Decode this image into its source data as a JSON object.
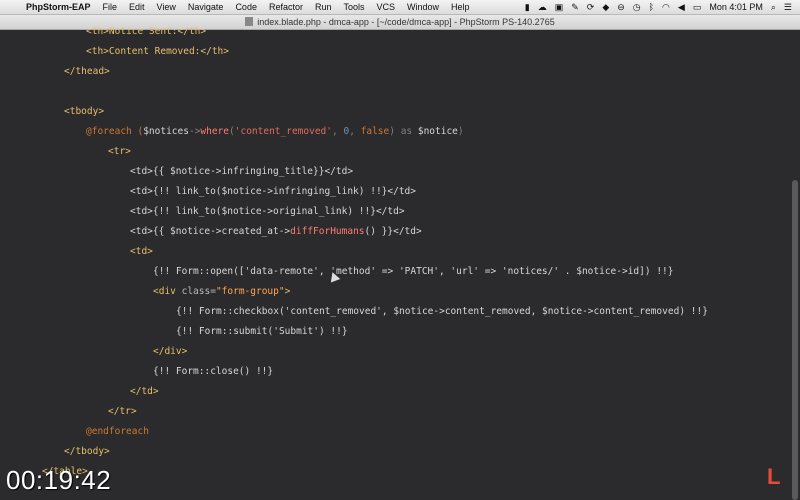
{
  "menubar": {
    "app": "PhpStorm-EAP",
    "items": [
      "File",
      "Edit",
      "View",
      "Navigate",
      "Code",
      "Refactor",
      "Run",
      "Tools",
      "VCS",
      "Window",
      "Help"
    ],
    "clock": "Mon 4:01 PM"
  },
  "window": {
    "title": "index.blade.php - dmca-app - [~/code/dmca-app] - PhpStorm PS-140.2765"
  },
  "code": {
    "l1": "<th>Notice Sent:</th>",
    "l2": "<th>Content Removed:</th>",
    "l3": "</thead>",
    "l4": "<tbody>",
    "l5a": "@foreach (",
    "l5b": "$notices",
    "l5c": "->",
    "l5d": "where",
    "l5e": "(",
    "l5f": "'content_removed'",
    "l5g": ", ",
    "l5h": "0",
    "l5i": ", ",
    "l5j": "false",
    "l5k": ") as ",
    "l5l": "$notice",
    "l5m": ")",
    "l6": "<tr>",
    "l7": "<td>{{ $notice->infringing_title}}</td>",
    "l8": "<td>{!! link_to($notice->infringing_link) !!}</td>",
    "l9": "<td>{!! link_to($notice->original_link) !!}</td>",
    "l10a": "<td>{{ $notice->created_at->",
    "l10b": "diffForHumans",
    "l10c": "() }}</td>",
    "l11": "<td>",
    "l12": "{!! Form::open(['data-remote', 'method' => 'PATCH', 'url' => 'notices/' . $notice->id]) !!}",
    "l13a": "<div ",
    "l13b": "class=",
    "l13c": "\"form-group\"",
    "l13d": ">",
    "l14": "{!! Form::checkbox('content_removed', $notice->content_removed, $notice->content_removed) !!}",
    "l15": "{!! Form::submit('Submit') !!}",
    "l16": "</div>",
    "l17": "{!! Form::close() !!}",
    "l18": "</td>",
    "l19": "</tr>",
    "l20": "@endforeach",
    "l21": "</tbody>",
    "l22": "</table>"
  },
  "overlay": {
    "timecode": "00:19:42",
    "logo": "L"
  }
}
